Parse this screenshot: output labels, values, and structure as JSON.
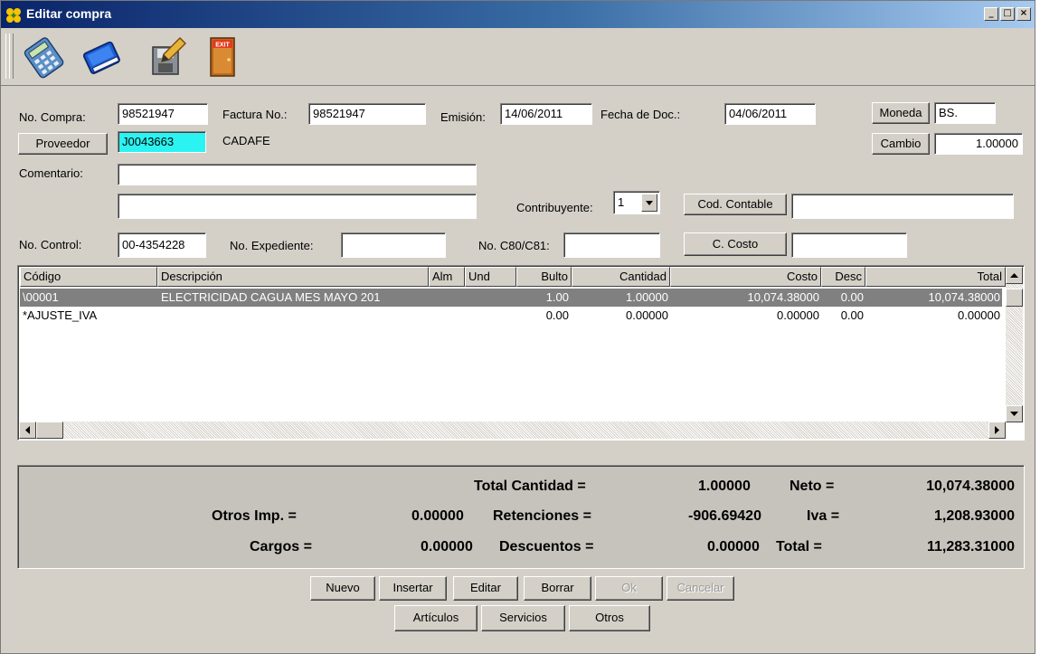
{
  "window": {
    "title": "Editar compra",
    "controls": [
      "_",
      "□",
      "×"
    ]
  },
  "toolbar": {
    "icons": [
      "calculator-icon",
      "book-icon",
      "edit-save-icon",
      "exit-door-icon"
    ],
    "exit_text": "EXIT"
  },
  "form": {
    "no_compra_label": "No. Compra:",
    "no_compra": "98521947",
    "factura_label": "Factura No.:",
    "factura": "98521947",
    "emision_label": "Emisión:",
    "emision": "14/06/2011",
    "fecha_doc_label": "Fecha de Doc.:",
    "fecha_doc": "04/06/2011",
    "moneda_button": "Moneda",
    "moneda": "BS.",
    "proveedor_button": "Proveedor",
    "proveedor_code": "J0043663",
    "proveedor_name": "CADAFE",
    "cambio_button": "Cambio",
    "cambio": "1.00000",
    "comentario_label": "Comentario:",
    "comentario_1": "",
    "comentario_2": "",
    "contribuyente_label": "Contribuyente:",
    "contribuyente": "1",
    "cod_contable_button": "Cod. Contable",
    "cod_contable": "",
    "no_control_label": "No. Control:",
    "no_control": "00-4354228",
    "no_expediente_label": "No. Expediente:",
    "no_expediente": "",
    "c80_label": "No. C80/C81:",
    "c80": "",
    "c_costo_button": "C. Costo",
    "c_costo": ""
  },
  "grid": {
    "columns": [
      "Código",
      "Descripción",
      "Alm",
      "Und",
      "Bulto",
      "Cantidad",
      "Costo",
      "Desc",
      "Total"
    ],
    "rows": [
      {
        "codigo": "\\00001",
        "descripcion": "ELECTRICIDAD  CAGUA MES MAYO 201",
        "alm": "",
        "und": "",
        "bulto": "1.00",
        "cantidad": "1.00000",
        "costo": "10,074.38000",
        "desc": "0.00",
        "total": "10,074.38000",
        "selected": true
      },
      {
        "codigo": "*AJUSTE_IVA",
        "descripcion": "",
        "alm": "",
        "und": "",
        "bulto": "0.00",
        "cantidad": "0.00000",
        "costo": "0.00000",
        "desc": "0.00",
        "total": "0.00000",
        "selected": false
      }
    ]
  },
  "totals": {
    "total_cantidad_label": "Total Cantidad =",
    "total_cantidad": "1.00000",
    "neto_label": "Neto =",
    "neto": "10,074.38000",
    "otros_imp_label": "Otros Imp. =",
    "otros_imp": "0.00000",
    "retenciones_label": "Retenciones =",
    "retenciones": "-906.69420",
    "iva_label": "Iva =",
    "iva": "1,208.93000",
    "cargos_label": "Cargos =",
    "cargos": "0.00000",
    "descuentos_label": "Descuentos =",
    "descuentos": "0.00000",
    "total_label": "Total =",
    "total": "11,283.31000"
  },
  "actions": {
    "nuevo": "Nuevo",
    "insertar": "Insertar",
    "editar": "Editar",
    "borrar": "Borrar",
    "ok": "Ok",
    "cancelar": "Cancelar",
    "articulos": "Artículos",
    "servicios": "Servicios",
    "otros": "Otros"
  }
}
